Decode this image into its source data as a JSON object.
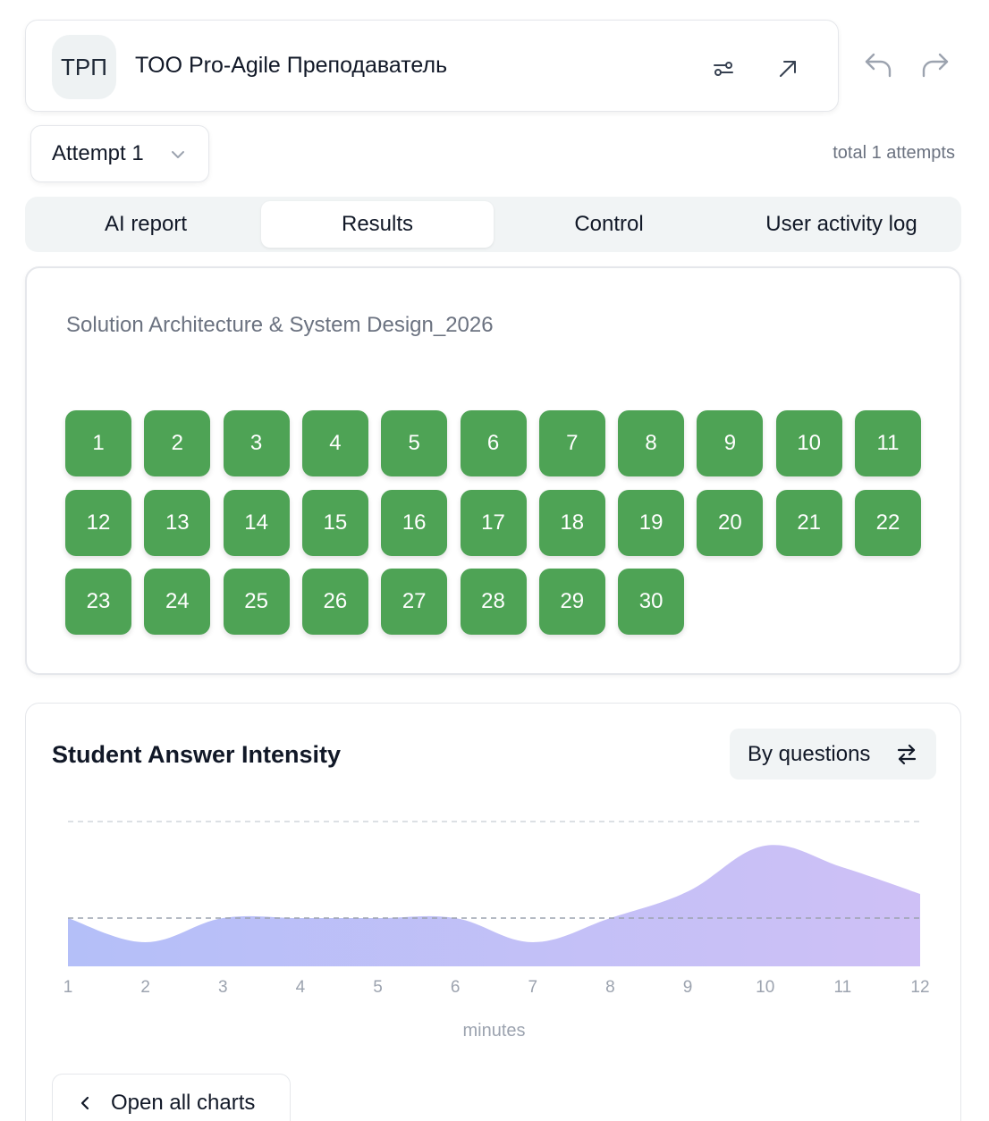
{
  "header": {
    "avatar_initials": "ТРП",
    "title": "ТОО Pro-Agile Преподаватель",
    "icons": [
      "sliders-icon",
      "external-link-icon",
      "undo-icon",
      "redo-icon"
    ]
  },
  "attempt": {
    "selected": "Attempt 1",
    "total_text": "total 1 attempts"
  },
  "tabs": [
    {
      "label": "AI report",
      "active": false
    },
    {
      "label": "Results",
      "active": true
    },
    {
      "label": "Control",
      "active": false
    },
    {
      "label": "User activity log",
      "active": false
    }
  ],
  "results": {
    "test_title": "Solution Architecture & System Design_2026",
    "questions": [
      "1",
      "2",
      "3",
      "4",
      "5",
      "6",
      "7",
      "8",
      "9",
      "10",
      "11",
      "12",
      "13",
      "14",
      "15",
      "16",
      "17",
      "18",
      "19",
      "20",
      "21",
      "22",
      "23",
      "24",
      "25",
      "26",
      "27",
      "28",
      "29",
      "30"
    ],
    "status_color": "#4ea355"
  },
  "intensity": {
    "title": "Student Answer Intensity",
    "toggle_label": "By questions",
    "open_all_label": "Open all charts"
  },
  "chart_data": {
    "type": "area",
    "title": "Student Answer Intensity",
    "xlabel": "minutes",
    "ylabel": "",
    "x": [
      1,
      2,
      3,
      4,
      5,
      6,
      7,
      8,
      9,
      10,
      11,
      12
    ],
    "values": [
      1.0,
      0.5,
      1.0,
      1.0,
      1.0,
      1.0,
      0.5,
      1.0,
      1.55,
      2.5,
      2.05,
      1.5
    ],
    "ylim": [
      0,
      3
    ],
    "reference_lines": [
      1,
      3
    ],
    "grid": false,
    "gradient": [
      "#b4bff8",
      "#cec0f6"
    ]
  }
}
